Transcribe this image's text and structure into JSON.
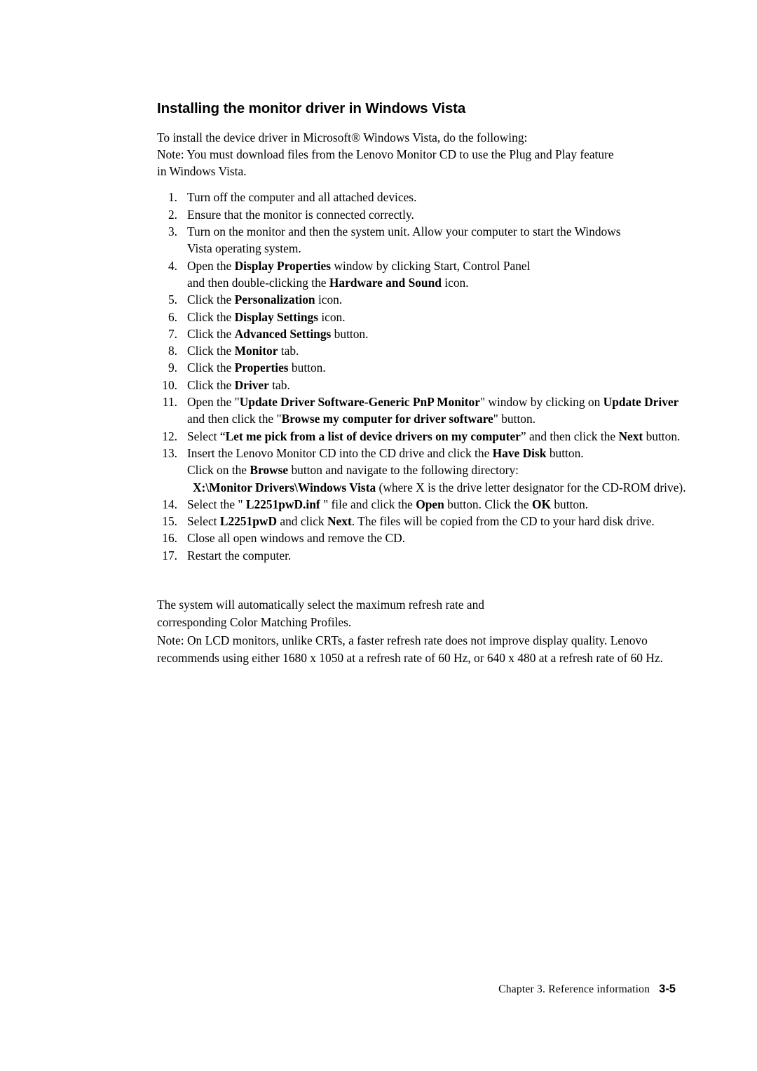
{
  "document": {
    "heading": "Installing the monitor driver in Windows Vista",
    "intro_lines": [
      "To install the device driver in Microsoft® Windows Vista, do the following:",
      "Note: You must download files from the Lenovo Monitor CD to use the Plug and Play feature",
      "in Windows Vista."
    ],
    "steps": [
      {
        "num": "1.",
        "lines": [
          [
            {
              "t": "Turn off the computer and all attached devices.",
              "b": false
            }
          ]
        ]
      },
      {
        "num": "2.",
        "lines": [
          [
            {
              "t": "Ensure that the monitor is connected correctly.",
              "b": false
            }
          ]
        ]
      },
      {
        "num": "3.",
        "lines": [
          [
            {
              "t": "Turn on the monitor and then the system unit. Allow your computer to start the Windows",
              "b": false
            }
          ],
          [
            {
              "t": "Vista operating system.",
              "b": false
            }
          ]
        ]
      },
      {
        "num": "4.",
        "lines": [
          [
            {
              "t": "Open the ",
              "b": false
            },
            {
              "t": "Display Properties",
              "b": true
            },
            {
              "t": " window by clicking Start, Control Panel",
              "b": false
            }
          ],
          [
            {
              "t": "and then double-clicking the ",
              "b": false
            },
            {
              "t": "Hardware and Sound",
              "b": true
            },
            {
              "t": " icon.",
              "b": false
            }
          ]
        ]
      },
      {
        "num": "5.",
        "lines": [
          [
            {
              "t": "Click the ",
              "b": false
            },
            {
              "t": "Personalization",
              "b": true
            },
            {
              "t": " icon.",
              "b": false
            }
          ]
        ]
      },
      {
        "num": "6.",
        "lines": [
          [
            {
              "t": "Click the ",
              "b": false
            },
            {
              "t": "Display Settings",
              "b": true
            },
            {
              "t": " icon.",
              "b": false
            }
          ]
        ]
      },
      {
        "num": "7.",
        "lines": [
          [
            {
              "t": "Click the ",
              "b": false
            },
            {
              "t": "Advanced Settings",
              "b": true
            },
            {
              "t": " button.",
              "b": false
            }
          ]
        ]
      },
      {
        "num": "8.",
        "lines": [
          [
            {
              "t": "Click the ",
              "b": false
            },
            {
              "t": "Monitor",
              "b": true
            },
            {
              "t": " tab.",
              "b": false
            }
          ]
        ]
      },
      {
        "num": "9.",
        "lines": [
          [
            {
              "t": "Click the ",
              "b": false
            },
            {
              "t": "Properties",
              "b": true
            },
            {
              "t": " button.",
              "b": false
            }
          ]
        ]
      },
      {
        "num": "10.",
        "lines": [
          [
            {
              "t": "Click the ",
              "b": false
            },
            {
              "t": "Driver",
              "b": true
            },
            {
              "t": " tab.",
              "b": false
            }
          ]
        ]
      },
      {
        "num": "11.",
        "lines": [
          [
            {
              "t": "Open the \"",
              "b": false
            },
            {
              "t": "Update Driver Software-Generic PnP Monitor",
              "b": true
            },
            {
              "t": "\" window by clicking on ",
              "b": false
            },
            {
              "t": "Update Driver",
              "b": true
            }
          ],
          [
            {
              "t": "and then click the \"",
              "b": false
            },
            {
              "t": "Browse my computer for driver software",
              "b": true
            },
            {
              "t": "\" button.",
              "b": false
            }
          ]
        ]
      },
      {
        "num": "12.",
        "lines": [
          [
            {
              "t": "Select “",
              "b": false
            },
            {
              "t": "Let me pick from a list of device drivers on my computer",
              "b": true
            },
            {
              "t": "” and then click the ",
              "b": false
            },
            {
              "t": "Next",
              "b": true
            },
            {
              "t": " button.",
              "b": false
            }
          ]
        ]
      },
      {
        "num": "13.",
        "lines": [
          [
            {
              "t": "Insert the Lenovo Monitor CD into the CD drive and click the ",
              "b": false
            },
            {
              "t": "Have Disk",
              "b": true
            },
            {
              "t": " button.",
              "b": false
            }
          ],
          [
            {
              "t": "Click on the ",
              "b": false
            },
            {
              "t": "Browse",
              "b": true
            },
            {
              "t": " button and navigate to the following directory:",
              "b": false
            }
          ],
          [
            {
              "t": "X:\\Monitor Drivers\\Windows Vista",
              "b": true
            },
            {
              "t": " (where X is the drive letter designator for the CD-ROM drive).",
              "b": false
            }
          ]
        ]
      },
      {
        "num": "14.",
        "lines": [
          [
            {
              "t": "Select the \" ",
              "b": false
            },
            {
              "t": "L2251pwD.inf",
              "b": true
            },
            {
              "t": " \" file and click the ",
              "b": false
            },
            {
              "t": "Open",
              "b": true
            },
            {
              "t": " button. Click the ",
              "b": false
            },
            {
              "t": "OK",
              "b": true
            },
            {
              "t": " button.",
              "b": false
            }
          ]
        ]
      },
      {
        "num": "15.",
        "lines": [
          [
            {
              "t": "Select ",
              "b": false
            },
            {
              "t": "L2251pwD",
              "b": true
            },
            {
              "t": " and click ",
              "b": false
            },
            {
              "t": "Next",
              "b": true
            },
            {
              "t": ". The files will be copied from the CD to your hard disk drive.",
              "b": false
            }
          ]
        ]
      },
      {
        "num": "16.",
        "lines": [
          [
            {
              "t": "Close all open windows and remove the CD.",
              "b": false
            }
          ]
        ]
      },
      {
        "num": "17.",
        "lines": [
          [
            {
              "t": "Restart the computer.",
              "b": false
            }
          ]
        ]
      }
    ],
    "closing_lines": [
      "The system will automatically select the maximum refresh rate and",
      "corresponding Color Matching Profiles.",
      "Note: On LCD monitors, unlike CRTs, a faster refresh rate does not improve display quality. Lenovo",
      "recommends using either 1680 x 1050 at a refresh rate of 60 Hz, or 640 x 480 at a refresh rate of 60 Hz."
    ],
    "footer": {
      "chapter": "Chapter 3. Reference information",
      "page_number": "3-5"
    }
  }
}
